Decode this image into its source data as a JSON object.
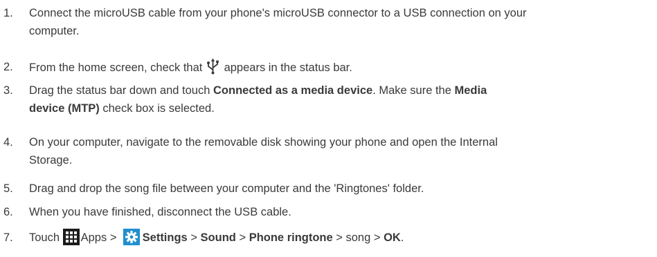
{
  "steps": [
    {
      "num": "1.",
      "line1": "Connect the microUSB cable from your phone's microUSB connector to a USB connection on your",
      "line2": "computer."
    },
    {
      "num": "2.",
      "before": "From the home screen, check that",
      "after": "appears in the status bar.",
      "icon": "usb-icon"
    },
    {
      "num": "3.",
      "p1": "Drag the status bar down and touch ",
      "b1": "Connected as a media device",
      "p2": ". Make sure the ",
      "b2": "Media",
      "b3": "device (MTP)",
      "p3": " check box is selected."
    },
    {
      "num": "4.",
      "line1": "On your computer, navigate to the removable disk showing your phone and open the Internal",
      "line2": "Storage."
    },
    {
      "num": "5.",
      "text": "Drag and drop the song file between your computer and the 'Ringtones' folder."
    },
    {
      "num": "6.",
      "text": "When you have finished, disconnect the USB cable."
    },
    {
      "num": "7.",
      "p1": "Touch",
      "apps": "Apps",
      "sep1": " > ",
      "settings": "Settings",
      "sep2": " > ",
      "sound": "Sound",
      "sep3": " > ",
      "ringtone": "Phone ringtone",
      "sep4": " > song > ",
      "ok": "OK",
      "end": ".",
      "icons": [
        "apps-grid-icon",
        "settings-gear-icon"
      ]
    }
  ],
  "colors": {
    "text": "#3a3a3a",
    "apps_icon_bg": "#1c1c1c",
    "settings_icon_bg": "#1f8fd0"
  }
}
